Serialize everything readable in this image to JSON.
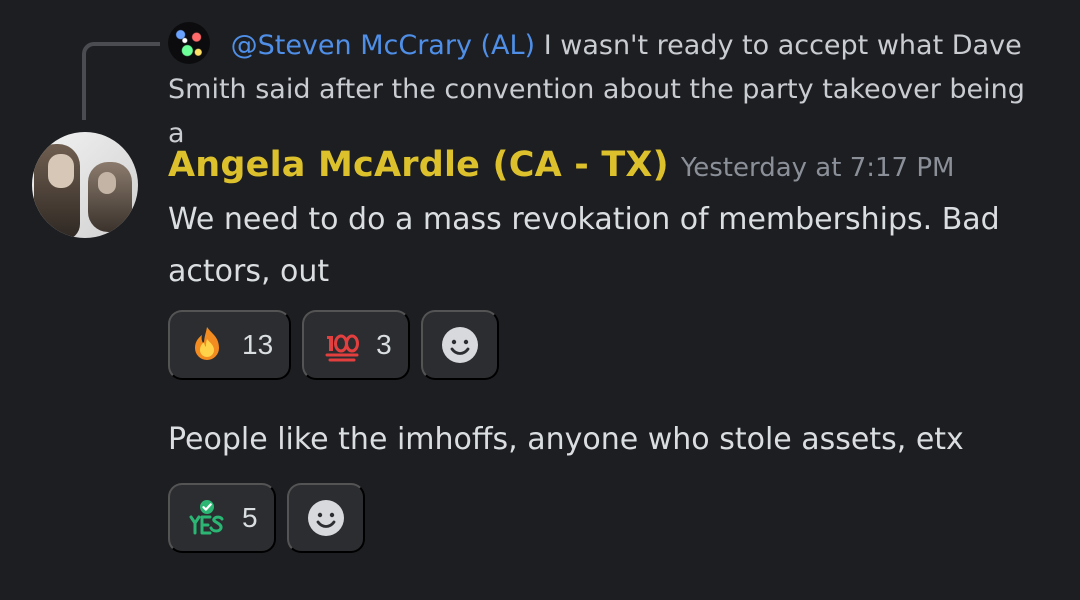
{
  "reply": {
    "mention": "@Steven McCrary (AL)",
    "text": "I wasn't ready to accept what Dave Smith said after the convention about the party takeover being a"
  },
  "message": {
    "author": "Angela McArdle (CA - TX)",
    "timestamp": "Yesterday at 7:17 PM",
    "text": "We need to do a mass revokation of memberships. Bad actors, out"
  },
  "reactions_1": [
    {
      "icon": "fire-icon",
      "count": "13"
    },
    {
      "icon": "hundred-icon",
      "count": "3"
    },
    {
      "icon": "add-reaction-icon"
    }
  ],
  "second_message": {
    "text": "People like the imhoffs, anyone who stole assets, etx"
  },
  "reactions_2": [
    {
      "icon": "yes-icon",
      "count": "5"
    },
    {
      "icon": "add-reaction-icon"
    }
  ],
  "colors": {
    "background": "#1d1e22",
    "author": "#ddc12c",
    "mention": "#4f8fe8",
    "reaction_bg": "#2b2d31",
    "timestamp": "#8a8f98"
  }
}
